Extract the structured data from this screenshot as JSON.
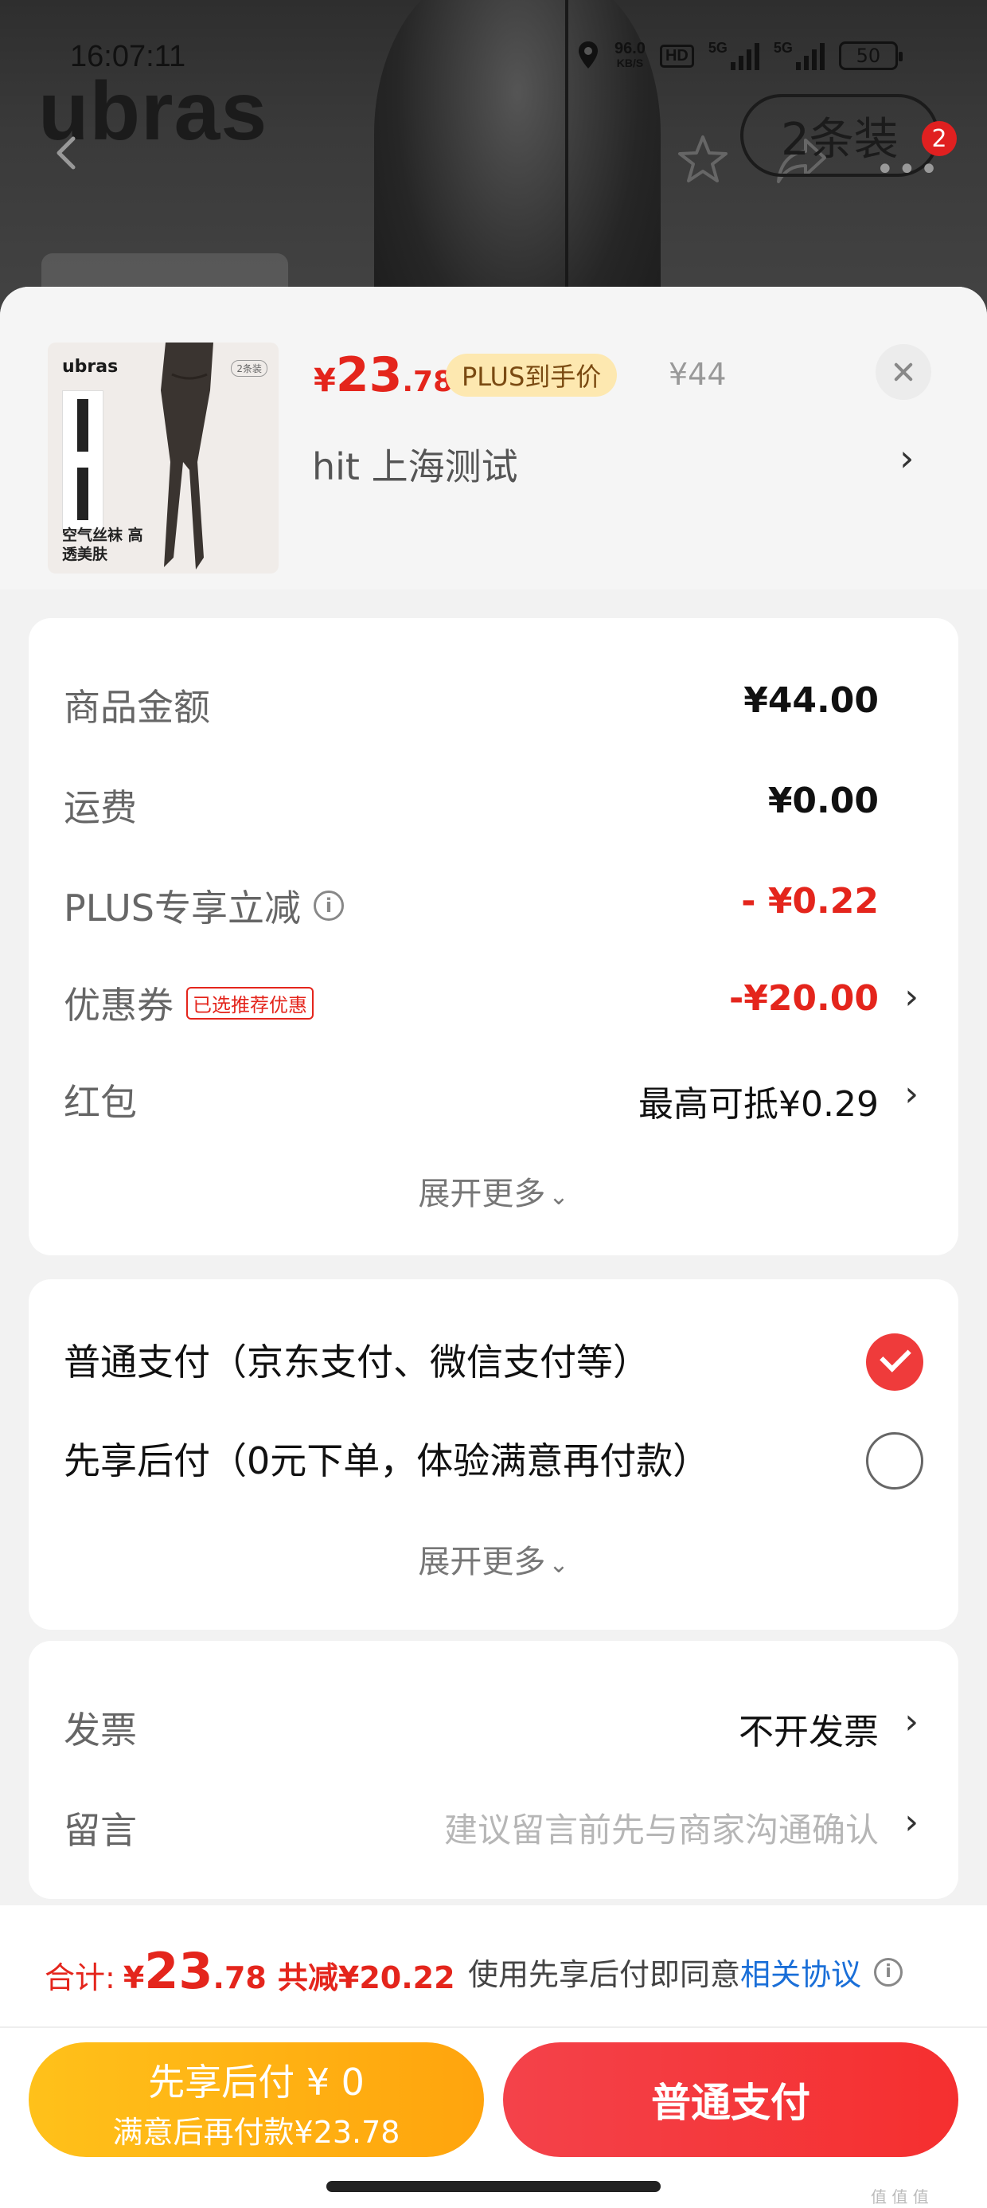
{
  "status_bar": {
    "time": "16:07:11",
    "net_speed": "96.0",
    "net_unit": "KB/S",
    "hd": "HD",
    "sig1": "5G",
    "sig2": "5G",
    "battery": "50"
  },
  "header": {
    "brand": "ubras",
    "pack_label": "2条装",
    "badge_count": "2"
  },
  "product": {
    "thumb_brand": "ubras",
    "thumb_tag": "2条装",
    "thumb_caption": "空气丝袜 高透美肤",
    "price_symbol": "¥",
    "price_int": "23",
    "price_dec": ".78",
    "plus_tag": "PLUS到手价",
    "orig_price": "¥44",
    "address": "hit  上海测试",
    "address_chevron": "›"
  },
  "fees": {
    "rows": [
      {
        "label": "商品金额",
        "value": "¥44.00"
      },
      {
        "label": "运费",
        "value": "¥0.00"
      },
      {
        "label": "PLUS专享立减",
        "value": "- ¥0.22"
      },
      {
        "label": "优惠券",
        "tag": "已选推荐优惠",
        "value": "-¥20.00"
      },
      {
        "label": "红包",
        "value": "最高可抵¥0.29"
      }
    ],
    "more": "展开更多",
    "chevron": "›"
  },
  "payment": {
    "options": [
      {
        "label": "普通支付（京东支付、微信支付等）",
        "selected": true
      },
      {
        "label": "先享后付（0元下单，体验满意再付款）",
        "selected": false
      }
    ],
    "more": "展开更多"
  },
  "extras": {
    "invoice_label": "发票",
    "invoice_value": "不开发票",
    "note_label": "留言",
    "note_placeholder": "建议留言前先与商家沟通确认"
  },
  "bottom": {
    "total_label": "合计:",
    "total_symbol": "¥",
    "total_int": "23",
    "total_dec": ".78",
    "saved": "共减¥20.22",
    "agree_text": "使用先享后付即同意",
    "agree_link": "相关协议",
    "btn_later_l1": "先享后付 ¥ 0",
    "btn_later_l2": "满意后再付款¥23.78",
    "btn_pay": "普通支付"
  },
  "watermark": "值 值 值",
  "colors": {
    "price_red": "#e4251c",
    "pay_red": "#f4424a",
    "later_yellow": "#ffb414",
    "link_blue": "#1a6fd8"
  },
  "icons": [
    "back-icon",
    "star-icon",
    "share-icon",
    "more-icon",
    "close-icon",
    "info-icon",
    "chevron-right-icon",
    "chevron-down-icon",
    "check-icon",
    "location-icon"
  ]
}
